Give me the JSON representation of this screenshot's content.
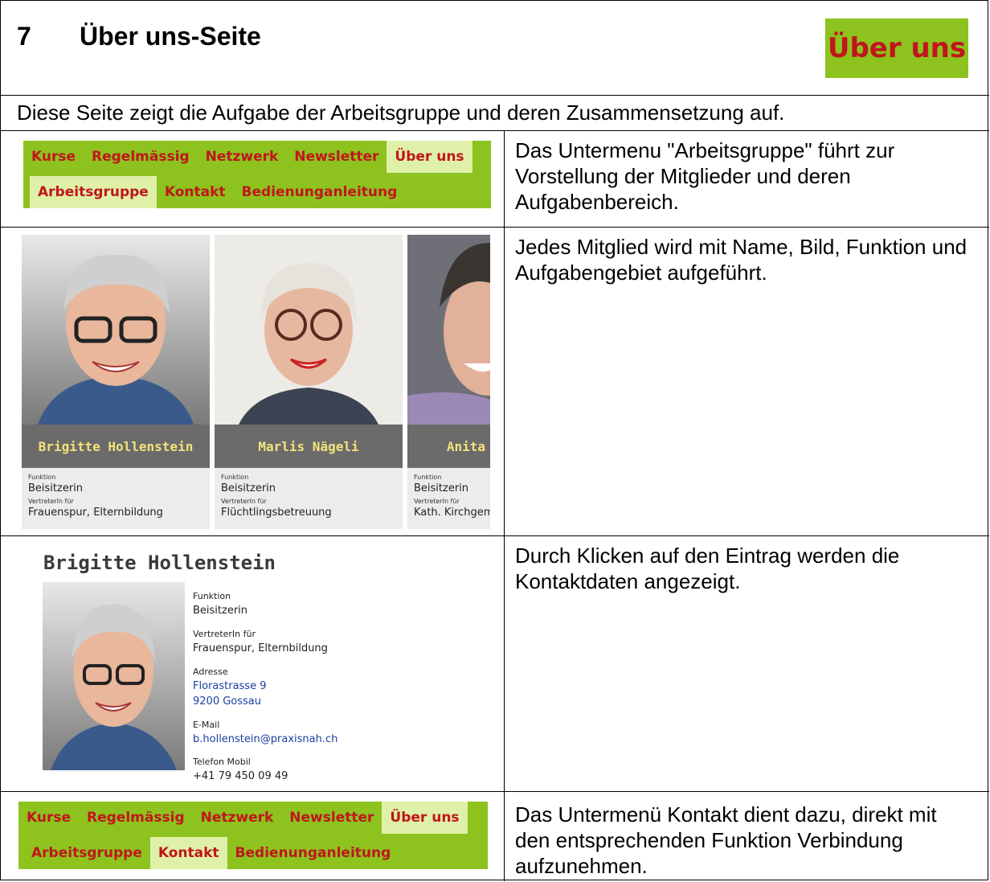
{
  "header": {
    "chapter_number": "7",
    "chapter_title": "Über uns-Seite",
    "badge": "Über uns"
  },
  "intro": "Diese Seite zeigt die Aufgabe der Arbeitsgruppe und deren Zusammensetzung auf.",
  "menu1": {
    "main": [
      "Kurse",
      "Regelmässig",
      "Netzwerk",
      "Newsletter",
      "Über uns"
    ],
    "sub": [
      "Arbeitsgruppe",
      "Kontakt",
      "Bedienunganleitung"
    ],
    "description": "Das Untermenu \"Arbeitsgruppe\" führt zur Vorstellung der Mitglieder und deren Aufgabenbereich."
  },
  "members": {
    "description": "Jedes Mitglied wird mit Name, Bild, Funktion und Aufgabengebiet aufgeführt.",
    "function_label": "Funktion",
    "rep_label": "VertreterIn für",
    "cards": [
      {
        "name": "Brigitte Hollenstein",
        "function": "Beisitzerin",
        "rep": "Frauenspur, Elternbildung"
      },
      {
        "name": "Marlis Nägeli",
        "function": "Beisitzerin",
        "rep": "Flüchtlingsbetreuung"
      },
      {
        "name": "Anita",
        "function": "Beisitzerin",
        "rep": "Kath. Kirchgeme"
      }
    ]
  },
  "detail": {
    "description": "Durch Klicken auf den Eintrag werden die Kontaktdaten angezeigt.",
    "name": "Brigitte Hollenstein",
    "function_label": "Funktion",
    "function": "Beisitzerin",
    "rep_label": "VertreterIn für",
    "rep": "Frauenspur, Elternbildung",
    "address_label": "Adresse",
    "street": "Florastrasse 9",
    "city": "9200 Gossau",
    "email_label": "E-Mail",
    "email": "b.hollenstein@praxisnah.ch",
    "phone_label": "Telefon Mobil",
    "phone": "+41 79 450 09 49"
  },
  "menu2": {
    "main": [
      "Kurse",
      "Regelmässig",
      "Netzwerk",
      "Newsletter",
      "Über uns"
    ],
    "sub": [
      "Arbeitsgruppe",
      "Kontakt",
      "Bedienunganleitung"
    ],
    "description": "Das Untermenü Kontakt dient dazu, direkt mit den entsprechenden Funktion Verbindung aufzunehmen."
  },
  "colors": {
    "menu_green": "#8dc21f",
    "menu_red": "#c0161b",
    "active_bg": "#dff0a8"
  }
}
